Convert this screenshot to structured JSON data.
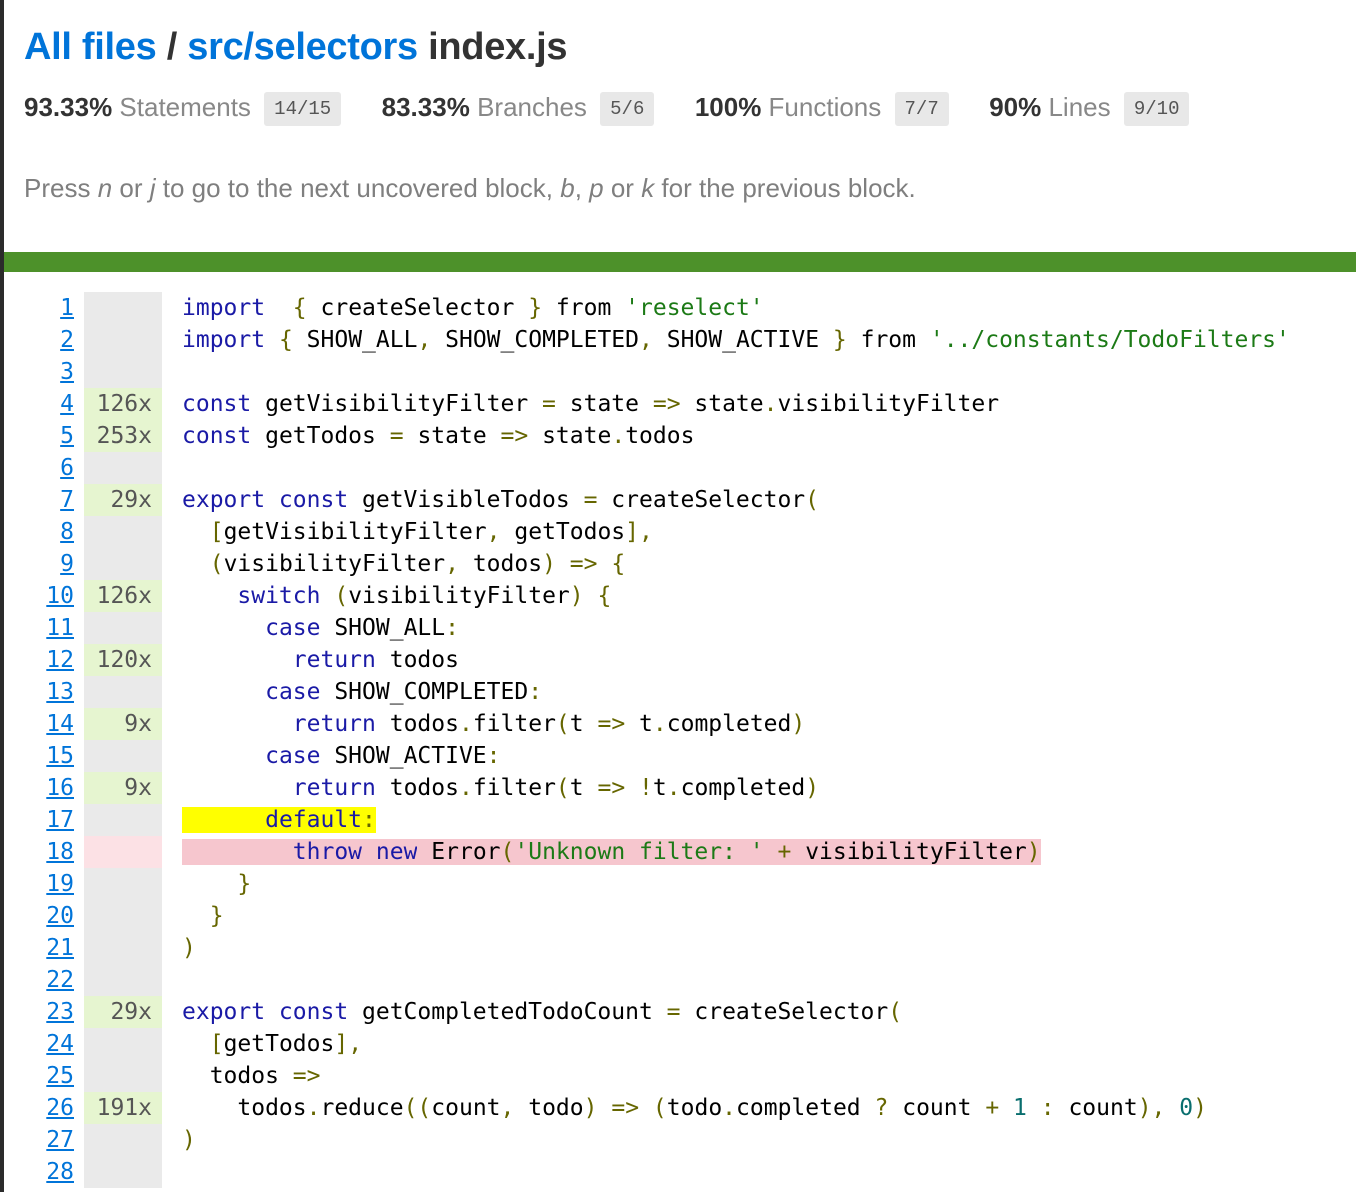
{
  "breadcrumb": {
    "all_files": "All files",
    "separator": "/",
    "folder": "src/selectors",
    "file": "index.js"
  },
  "stats": [
    {
      "pct": "93.33%",
      "label": "Statements",
      "fraction": "14/15"
    },
    {
      "pct": "83.33%",
      "label": "Branches",
      "fraction": "5/6"
    },
    {
      "pct": "100%",
      "label": "Functions",
      "fraction": "7/7"
    },
    {
      "pct": "90%",
      "label": "Lines",
      "fraction": "9/10"
    }
  ],
  "hint": {
    "t1": "Press ",
    "k1": "n",
    "t2": " or ",
    "k2": "j",
    "t3": " to go to the next uncovered block, ",
    "k3": "b",
    "t4": ", ",
    "k4": "p",
    "t5": " or ",
    "k5": "k",
    "t6": " for the previous block."
  },
  "colors": {
    "link": "#0074d9",
    "coverage_bar": "#4d912a",
    "covered_line": "#e6f5d0",
    "uncovered_line": "#fce1e5",
    "branch_not_taken": "#ffff00",
    "statement_not_covered": "#f6c6ce"
  },
  "lines": [
    {
      "n": "1",
      "count": "",
      "status": "neutral"
    },
    {
      "n": "2",
      "count": "",
      "status": "neutral"
    },
    {
      "n": "3",
      "count": "",
      "status": "neutral"
    },
    {
      "n": "4",
      "count": "126x",
      "status": "yes"
    },
    {
      "n": "5",
      "count": "253x",
      "status": "yes"
    },
    {
      "n": "6",
      "count": "",
      "status": "neutral"
    },
    {
      "n": "7",
      "count": "29x",
      "status": "yes"
    },
    {
      "n": "8",
      "count": "",
      "status": "neutral"
    },
    {
      "n": "9",
      "count": "",
      "status": "neutral"
    },
    {
      "n": "10",
      "count": "126x",
      "status": "yes"
    },
    {
      "n": "11",
      "count": "",
      "status": "neutral"
    },
    {
      "n": "12",
      "count": "120x",
      "status": "yes"
    },
    {
      "n": "13",
      "count": "",
      "status": "neutral"
    },
    {
      "n": "14",
      "count": "9x",
      "status": "yes"
    },
    {
      "n": "15",
      "count": "",
      "status": "neutral"
    },
    {
      "n": "16",
      "count": "9x",
      "status": "yes"
    },
    {
      "n": "17",
      "count": "",
      "status": "neutral"
    },
    {
      "n": "18",
      "count": "",
      "status": "no"
    },
    {
      "n": "19",
      "count": "",
      "status": "neutral"
    },
    {
      "n": "20",
      "count": "",
      "status": "neutral"
    },
    {
      "n": "21",
      "count": "",
      "status": "neutral"
    },
    {
      "n": "22",
      "count": "",
      "status": "neutral"
    },
    {
      "n": "23",
      "count": "29x",
      "status": "yes"
    },
    {
      "n": "24",
      "count": "",
      "status": "neutral"
    },
    {
      "n": "25",
      "count": "",
      "status": "neutral"
    },
    {
      "n": "26",
      "count": "191x",
      "status": "yes"
    },
    {
      "n": "27",
      "count": "",
      "status": "neutral"
    },
    {
      "n": "28",
      "count": "",
      "status": "neutral"
    }
  ],
  "source": [
    [
      [
        "kw",
        "import"
      ],
      [
        "",
        "  "
      ],
      [
        "pun",
        "{"
      ],
      [
        "",
        " createSelector "
      ],
      [
        "pun",
        "}"
      ],
      [
        "",
        " from "
      ],
      [
        "str",
        "'reselect'"
      ]
    ],
    [
      [
        "kw",
        "import"
      ],
      [
        "",
        " "
      ],
      [
        "pun",
        "{"
      ],
      [
        "",
        " SHOW_ALL"
      ],
      [
        "pun",
        ","
      ],
      [
        "",
        " SHOW_COMPLETED"
      ],
      [
        "pun",
        ","
      ],
      [
        "",
        " SHOW_ACTIVE "
      ],
      [
        "pun",
        "}"
      ],
      [
        "",
        " from "
      ],
      [
        "str",
        "'../constants/TodoFilters'"
      ]
    ],
    [],
    [
      [
        "kw",
        "const"
      ],
      [
        "",
        " getVisibilityFilter "
      ],
      [
        "pun",
        "="
      ],
      [
        "",
        " state "
      ],
      [
        "pun",
        "=>"
      ],
      [
        "",
        " state"
      ],
      [
        "pun",
        "."
      ],
      [
        "",
        "visibilityFilter"
      ]
    ],
    [
      [
        "kw",
        "const"
      ],
      [
        "",
        " getTodos "
      ],
      [
        "pun",
        "="
      ],
      [
        "",
        " state "
      ],
      [
        "pun",
        "=>"
      ],
      [
        "",
        " state"
      ],
      [
        "pun",
        "."
      ],
      [
        "",
        "todos"
      ]
    ],
    [],
    [
      [
        "kw",
        "export const"
      ],
      [
        "",
        " getVisibleTodos "
      ],
      [
        "pun",
        "="
      ],
      [
        "",
        " createSelector"
      ],
      [
        "pun",
        "("
      ]
    ],
    [
      [
        "",
        "  "
      ],
      [
        "pun",
        "["
      ],
      [
        "",
        "getVisibilityFilter"
      ],
      [
        "pun",
        ","
      ],
      [
        "",
        " getTodos"
      ],
      [
        "pun",
        "],"
      ]
    ],
    [
      [
        "",
        "  "
      ],
      [
        "pun",
        "("
      ],
      [
        "",
        "visibilityFilter"
      ],
      [
        "pun",
        ","
      ],
      [
        "",
        " todos"
      ],
      [
        "pun",
        ")"
      ],
      [
        "",
        " "
      ],
      [
        "pun",
        "=>"
      ],
      [
        "",
        " "
      ],
      [
        "pun",
        "{"
      ]
    ],
    [
      [
        "",
        "    "
      ],
      [
        "kw",
        "switch"
      ],
      [
        "",
        " "
      ],
      [
        "pun",
        "("
      ],
      [
        "",
        "visibilityFilter"
      ],
      [
        "pun",
        ")"
      ],
      [
        "",
        " "
      ],
      [
        "pun",
        "{"
      ]
    ],
    [
      [
        "",
        "      "
      ],
      [
        "kw",
        "case"
      ],
      [
        "",
        " SHOW_ALL"
      ],
      [
        "pun",
        ":"
      ]
    ],
    [
      [
        "",
        "        "
      ],
      [
        "kw",
        "return"
      ],
      [
        "",
        " todos"
      ]
    ],
    [
      [
        "",
        "      "
      ],
      [
        "kw",
        "case"
      ],
      [
        "",
        " SHOW_COMPLETED"
      ],
      [
        "pun",
        ":"
      ]
    ],
    [
      [
        "",
        "        "
      ],
      [
        "kw",
        "return"
      ],
      [
        "",
        " todos"
      ],
      [
        "pun",
        "."
      ],
      [
        "",
        "filter"
      ],
      [
        "pun",
        "("
      ],
      [
        "",
        "t "
      ],
      [
        "pun",
        "=>"
      ],
      [
        "",
        " t"
      ],
      [
        "pun",
        "."
      ],
      [
        "",
        "completed"
      ],
      [
        "pun",
        ")"
      ]
    ],
    [
      [
        "",
        "      "
      ],
      [
        "kw",
        "case"
      ],
      [
        "",
        " SHOW_ACTIVE"
      ],
      [
        "pun",
        ":"
      ]
    ],
    [
      [
        "",
        "        "
      ],
      [
        "kw",
        "return"
      ],
      [
        "",
        " todos"
      ],
      [
        "pun",
        "."
      ],
      [
        "",
        "filter"
      ],
      [
        "pun",
        "("
      ],
      [
        "",
        "t "
      ],
      [
        "pun",
        "=>"
      ],
      [
        "",
        " "
      ],
      [
        "pun",
        "!"
      ],
      [
        "",
        "t"
      ],
      [
        "pun",
        "."
      ],
      [
        "",
        "completed"
      ],
      [
        "pun",
        ")"
      ]
    ],
    [
      [
        "y",
        "      "
      ],
      [
        "kw y",
        "default"
      ],
      [
        "pun y",
        ":"
      ]
    ],
    [
      [
        "r",
        "        "
      ],
      [
        "kw r",
        "throw"
      ],
      [
        "r",
        " "
      ],
      [
        "kw r",
        "new"
      ],
      [
        "r",
        " Error"
      ],
      [
        "pun r",
        "("
      ],
      [
        "str r",
        "'Unknown filter: '"
      ],
      [
        "r",
        " "
      ],
      [
        "pun r",
        "+"
      ],
      [
        "r",
        " visibilityFilter"
      ],
      [
        "pun r",
        ")"
      ]
    ],
    [
      [
        "",
        "    "
      ],
      [
        "pun",
        "}"
      ]
    ],
    [
      [
        "",
        "  "
      ],
      [
        "pun",
        "}"
      ]
    ],
    [
      [
        "pun",
        ")"
      ]
    ],
    [],
    [
      [
        "kw",
        "export const"
      ],
      [
        "",
        " getCompletedTodoCount "
      ],
      [
        "pun",
        "="
      ],
      [
        "",
        " createSelector"
      ],
      [
        "pun",
        "("
      ]
    ],
    [
      [
        "",
        "  "
      ],
      [
        "pun",
        "["
      ],
      [
        "",
        "getTodos"
      ],
      [
        "pun",
        "],"
      ]
    ],
    [
      [
        "",
        "  todos "
      ],
      [
        "pun",
        "=>"
      ]
    ],
    [
      [
        "",
        "    todos"
      ],
      [
        "pun",
        "."
      ],
      [
        "",
        "reduce"
      ],
      [
        "pun",
        "(("
      ],
      [
        "",
        "count"
      ],
      [
        "pun",
        ","
      ],
      [
        "",
        " todo"
      ],
      [
        "pun",
        ")"
      ],
      [
        "",
        " "
      ],
      [
        "pun",
        "=>"
      ],
      [
        "",
        " "
      ],
      [
        "pun",
        "("
      ],
      [
        "",
        "todo"
      ],
      [
        "pun",
        "."
      ],
      [
        "",
        "completed "
      ],
      [
        "pun",
        "?"
      ],
      [
        "",
        " count "
      ],
      [
        "pun",
        "+"
      ],
      [
        "",
        " "
      ],
      [
        "num",
        "1"
      ],
      [
        "",
        " "
      ],
      [
        "pun",
        ":"
      ],
      [
        "",
        " count"
      ],
      [
        "pun",
        "),"
      ],
      [
        "",
        " "
      ],
      [
        "num",
        "0"
      ],
      [
        "pun",
        ")"
      ]
    ],
    [
      [
        "pun",
        ")"
      ]
    ],
    []
  ]
}
